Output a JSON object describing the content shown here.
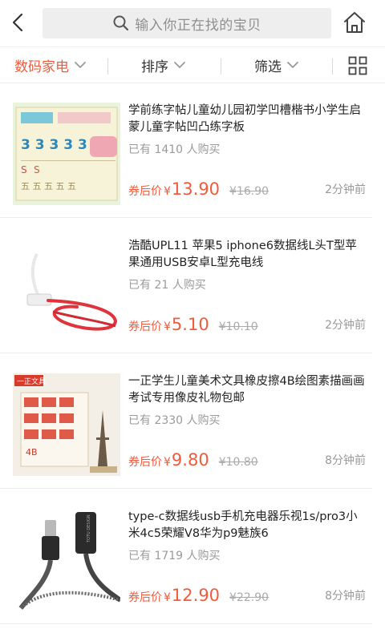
{
  "header": {
    "search_placeholder": "输入你正在找的宝贝",
    "icons": [
      "back-arrow-icon",
      "search-icon",
      "home-icon"
    ]
  },
  "filters": {
    "category": "数码家电",
    "sort": "排序",
    "screen": "筛选",
    "accent_color": "#f25a3c",
    "layout_icon": "grid-icon"
  },
  "products": [
    {
      "title": "学前练字帖儿童幼儿园初学凹槽楷书小学生启蒙儿童字帖凹凸练字板",
      "sold": "已有 1410 人购买",
      "price_label": "券后价",
      "currency": "¥",
      "price": "13.90",
      "original_price": "¥16.90",
      "time": "2分钟前"
    },
    {
      "title": "浩酷UPL11 苹果5 iphone6数据线L头T型苹果通用USB安卓L型充电线",
      "sold": "已有 21 人购买",
      "price_label": "券后价",
      "currency": "¥",
      "price": "5.10",
      "original_price": "¥10.10",
      "time": "2分钟前"
    },
    {
      "title": "一正学生儿童美术文具橡皮擦4B绘图素描画画考试专用像皮礼物包邮",
      "sold": "已有 2330 人购买",
      "price_label": "券后价",
      "currency": "¥",
      "price": "9.80",
      "original_price": "¥10.80",
      "time": "8分钟前"
    },
    {
      "title": "type-c数据线usb手机充电器乐视1s/pro3小米4c5荣耀V8华为p9魅族6",
      "sold": "已有 1719 人购买",
      "price_label": "券后价",
      "currency": "¥",
      "price": "12.90",
      "original_price": "¥22.90",
      "time": "8分钟前"
    }
  ],
  "thumb_text": {
    "p1_digits": "3 3 3 3 3 3",
    "p1_chars": "五 五 五 五 五",
    "p3_brand": "一正文具",
    "p3_box_label": "4B",
    "p4_brand": "TOTU DESIGN"
  }
}
